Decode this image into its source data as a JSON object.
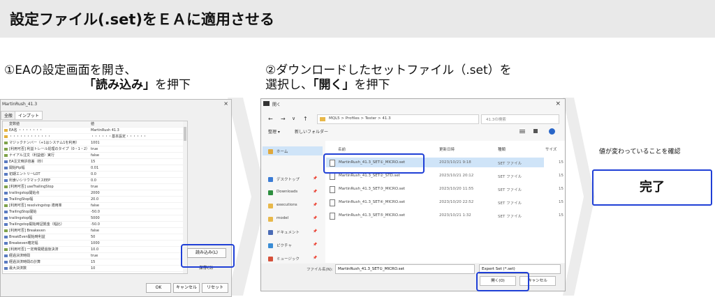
{
  "header": {
    "title": "設定ファイル(.set)をＥＡに適用させる"
  },
  "step1": {
    "line1": "①EAの設定画面を開き、",
    "quote": "「読み込み」",
    "suffix": "を押下"
  },
  "step2": {
    "line1": "②ダウンロードしたセットファイル（.set）を",
    "line2_prefix": "選択し、",
    "quote": "「開く」",
    "suffix": "を押下"
  },
  "ea_dialog": {
    "title": "MartinRush_41.3",
    "close": "×",
    "tabs": [
      "全般",
      "インプット"
    ],
    "col_variable": "変数値",
    "col_value": "値",
    "rows": [
      {
        "name": "EA名 ・・・・・・・",
        "value": "MartinRush 41.3",
        "icon": "#e3b13c"
      },
      {
        "name": "・・・・・・・・・・・・",
        "value": "・・・・・・基本設定・・・・・・",
        "icon": "#e3b13c"
      },
      {
        "name": "マジックナンバー（+1はシステム1を利用）",
        "value": "1001",
        "icon": "#7fa24a"
      },
      {
        "name": "[利用可否] 利益トレール処理のタイプ（0・1・2）",
        "value": "true",
        "icon": "#7fa24a"
      },
      {
        "name": "ナイアル注文（利益値）実行",
        "value": "false",
        "icon": "#7fa24a"
      },
      {
        "name": "EA注文時許容差（秒）",
        "value": "15",
        "icon": "#5a7bc1"
      },
      {
        "name": "開始Pip幅",
        "value": "0.01",
        "icon": "#5a7bc1"
      },
      {
        "name": "初期エントリーLOT",
        "value": "0.0",
        "icon": "#5a7bc1"
      },
      {
        "name": "利食いシリウマックスEEP",
        "value": "0.0",
        "icon": "#5a7bc1"
      },
      {
        "name": "[利用可否] useTrailingStop",
        "value": "true",
        "icon": "#7fa24a"
      },
      {
        "name": "trailingstop開始点",
        "value": "2000",
        "icon": "#5a7bc1"
      },
      {
        "name": "TrailingStop幅",
        "value": "20.0",
        "icon": "#5a7bc1"
      },
      {
        "name": "[利用可否] resolvingstop 適用率",
        "value": "false",
        "icon": "#7fa24a"
      },
      {
        "name": "TrailingStop開始",
        "value": "-50.0",
        "icon": "#5a7bc1"
      },
      {
        "name": "trailingstop幅",
        "value": "5000",
        "icon": "#5a7bc1"
      },
      {
        "name": "Trailingstop開始時証拠金（幅比）",
        "value": "-50.0",
        "icon": "#5a7bc1"
      },
      {
        "name": "[利用可否] Breakeven",
        "value": "false",
        "icon": "#7fa24a"
      },
      {
        "name": "BreakEven開始時利益",
        "value": "50",
        "icon": "#5a7bc1"
      },
      {
        "name": "Breakeven確定幅",
        "value": "1000",
        "icon": "#5a7bc1"
      },
      {
        "name": "[利用可否] 一定時間経過後決済",
        "value": "10.0",
        "icon": "#7fa24a"
      },
      {
        "name": "経過決済時間",
        "value": "true",
        "icon": "#5a7bc1"
      },
      {
        "name": "経過決済時間の計算",
        "value": "15",
        "icon": "#5a7bc1"
      },
      {
        "name": "最大決済数",
        "value": "10",
        "icon": "#5a7bc1"
      }
    ],
    "load_button": "読み込み(L)",
    "save_button": "保存(S)",
    "ok_button": "OK",
    "cancel_button": "キャンセル",
    "reset_button": "リセット"
  },
  "file_dialog": {
    "title": "開く",
    "close": "×",
    "nav_back": "←",
    "nav_forward": "→",
    "nav_dropdown": "∨",
    "nav_up": "↑",
    "breadcrumb": [
      "MQL5",
      "Profiles",
      "Tester",
      "41.3"
    ],
    "search_placeholder": "41.3の検索",
    "organize": "整理 ▾",
    "new_folder": "新しいフォルダー",
    "col_name": "名前",
    "col_date": "更新日時",
    "col_type": "種類",
    "col_size": "サイズ",
    "nav_items": [
      {
        "label": "ホーム",
        "icon": "home-icon",
        "color": "#e0a83c",
        "pin": ""
      },
      {
        "label": "デスクトップ",
        "icon": "desktop-icon",
        "color": "#3a7bd5",
        "pin": "📌"
      },
      {
        "label": "Downloads",
        "icon": "download-icon",
        "color": "#2d8e3f",
        "pin": "📌"
      },
      {
        "label": "executions",
        "icon": "folder-icon",
        "color": "#e8b84a",
        "pin": "📌"
      },
      {
        "label": "model",
        "icon": "folder-icon",
        "color": "#e8b84a",
        "pin": "📌"
      },
      {
        "label": "ドキュメント",
        "icon": "document-icon",
        "color": "#4a6bb5",
        "pin": "📌"
      },
      {
        "label": "ピクチャ",
        "icon": "picture-icon",
        "color": "#3a8cd5",
        "pin": "📌"
      },
      {
        "label": "ミュージック",
        "icon": "music-icon",
        "color": "#d5503a",
        "pin": "📌"
      }
    ],
    "files": [
      {
        "name": "MartinRush_41.3_SET①_MICRO.set",
        "date": "2023/10/21 9:18",
        "type": "SET ファイル",
        "size": "15"
      },
      {
        "name": "MartinRush_41.3_SET②_STD.set",
        "date": "2023/10/21 20:12",
        "type": "SET ファイル",
        "size": "15"
      },
      {
        "name": "MartinRush_41.3_SET③_MICRO.set",
        "date": "2023/10/20 11:55",
        "type": "SET ファイル",
        "size": "15"
      },
      {
        "name": "MartinRush_41.3_SET④_MICRO.set",
        "date": "2023/10/20 22:52",
        "type": "SET ファイル",
        "size": "15"
      },
      {
        "name": "MartinRush_41.3_SET⑤_MICRO.set",
        "date": "2023/10/21 1:32",
        "type": "SET ファイル",
        "size": "15"
      }
    ],
    "filename_label": "ファイル名(N):",
    "filename_value": "MartinRush_41.3_SET①_MICRO.set",
    "filter_value": "Expert Set (*.set)",
    "open_button": "開く(O)",
    "cancel_button": "キャンセル"
  },
  "right": {
    "confirm_text": "値が変わっていることを確認",
    "done_label": "完了"
  },
  "colors": {
    "highlight": "#1f3fd6",
    "header_bg": "#e9e9e9",
    "selection": "#cfe4f8"
  }
}
